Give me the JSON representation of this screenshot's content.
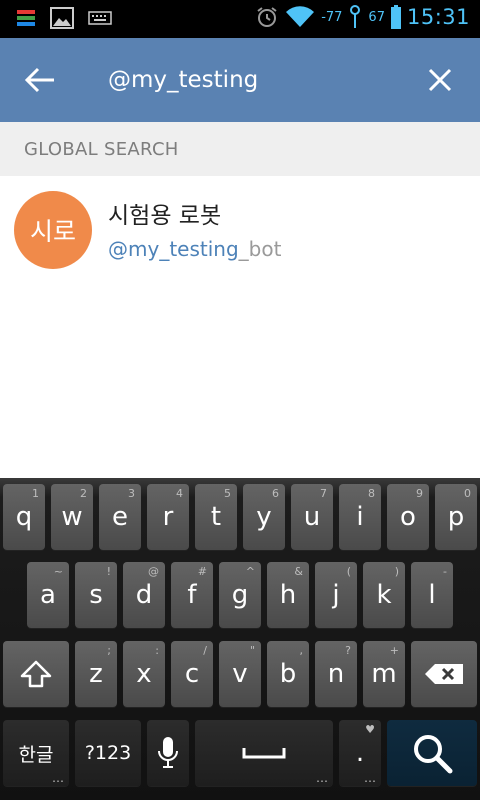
{
  "status_bar": {
    "signal_text": "-77",
    "battery_text": "67",
    "time": "15:31",
    "icons": [
      "sim-icon",
      "gallery-icon",
      "keyboard-notification-icon",
      "alarm-icon",
      "wifi-icon",
      "signal-icon",
      "battery-icon"
    ]
  },
  "app_bar": {
    "back_icon": "arrow-left-icon",
    "search_value": "@my_testing",
    "clear_icon": "close-icon",
    "background": "#5a82b2"
  },
  "section": {
    "title": "GLOBAL SEARCH"
  },
  "results": [
    {
      "avatar_text": "시로",
      "avatar_color": "#f08a4a",
      "name": "시험용 로봇",
      "handle_match": "@my_testing",
      "handle_rest": "_bot"
    }
  ],
  "keyboard": {
    "row1": [
      {
        "label": "q",
        "hint": "1"
      },
      {
        "label": "w",
        "hint": "2"
      },
      {
        "label": "e",
        "hint": "3"
      },
      {
        "label": "r",
        "hint": "4"
      },
      {
        "label": "t",
        "hint": "5"
      },
      {
        "label": "y",
        "hint": "6"
      },
      {
        "label": "u",
        "hint": "7"
      },
      {
        "label": "i",
        "hint": "8"
      },
      {
        "label": "o",
        "hint": "9"
      },
      {
        "label": "p",
        "hint": "0"
      }
    ],
    "row2": [
      {
        "label": "a",
        "hint": "~"
      },
      {
        "label": "s",
        "hint": "!"
      },
      {
        "label": "d",
        "hint": "@"
      },
      {
        "label": "f",
        "hint": "#"
      },
      {
        "label": "g",
        "hint": "^"
      },
      {
        "label": "h",
        "hint": "&"
      },
      {
        "label": "j",
        "hint": "("
      },
      {
        "label": "k",
        "hint": ")"
      },
      {
        "label": "l",
        "hint": "-"
      }
    ],
    "row3": [
      {
        "label": "z",
        "hint": ";"
      },
      {
        "label": "x",
        "hint": ":"
      },
      {
        "label": "c",
        "hint": "/"
      },
      {
        "label": "v",
        "hint": "\""
      },
      {
        "label": "b",
        "hint": ","
      },
      {
        "label": "n",
        "hint": "?"
      },
      {
        "label": "m",
        "hint": "+"
      }
    ],
    "shift_icon": "shift-icon",
    "backspace_icon": "backspace-icon",
    "lang_label": "한글",
    "symbols_label": "?123",
    "mic_icon": "microphone-icon",
    "space_icon": "space-bar-icon",
    "period_label": ".",
    "search_icon": "search-icon"
  }
}
